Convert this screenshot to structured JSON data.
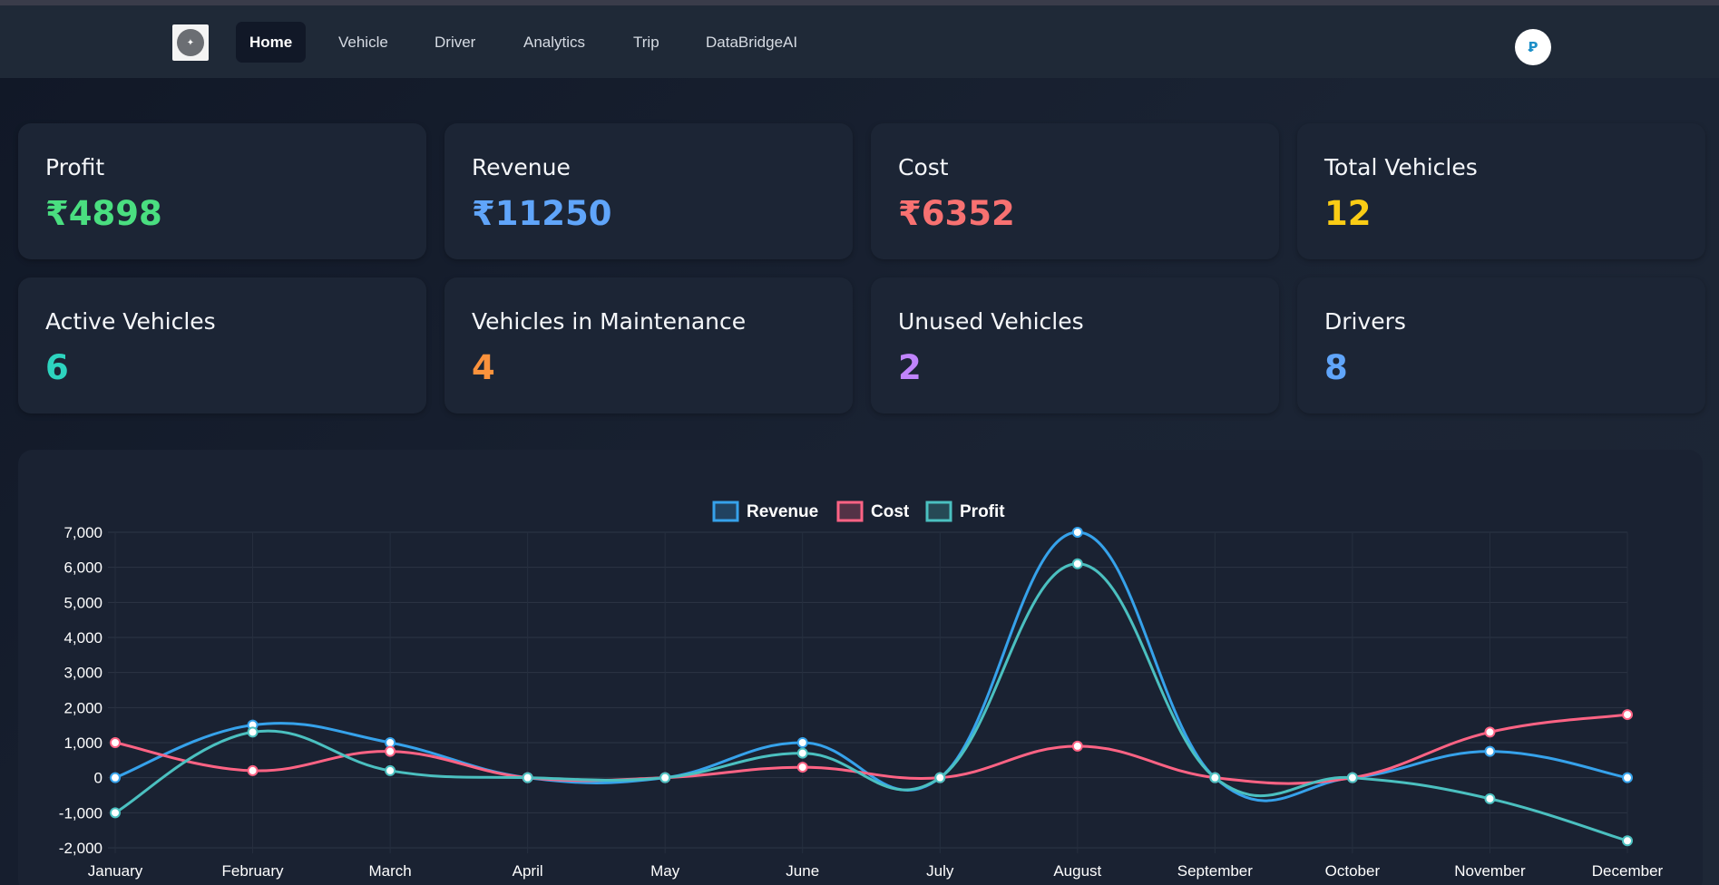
{
  "nav": {
    "logo_name": "company-logo",
    "items": [
      {
        "label": "Home",
        "active": true
      },
      {
        "label": "Vehicle",
        "active": false
      },
      {
        "label": "Driver",
        "active": false
      },
      {
        "label": "Analytics",
        "active": false
      },
      {
        "label": "Trip",
        "active": false
      },
      {
        "label": "DataBridgeAI",
        "active": false
      }
    ],
    "avatar_icon": "user-avatar-icon"
  },
  "cards": [
    {
      "label": "Profit",
      "value": "₹4898",
      "color": "#4ade80"
    },
    {
      "label": "Revenue",
      "value": "₹11250",
      "color": "#60a5fa"
    },
    {
      "label": "Cost",
      "value": "₹6352",
      "color": "#f87171"
    },
    {
      "label": "Total Vehicles",
      "value": "12",
      "color": "#facc15"
    },
    {
      "label": "Active Vehicles",
      "value": "6",
      "color": "#2dd4bf"
    },
    {
      "label": "Vehicles in Maintenance",
      "value": "4",
      "color": "#fb923c"
    },
    {
      "label": "Unused Vehicles",
      "value": "2",
      "color": "#c084fc"
    },
    {
      "label": "Drivers",
      "value": "8",
      "color": "#60a5fa"
    }
  ],
  "chart_data": {
    "type": "line",
    "categories": [
      "January",
      "February",
      "March",
      "April",
      "May",
      "June",
      "July",
      "August",
      "September",
      "October",
      "November",
      "December"
    ],
    "series": [
      {
        "name": "Revenue",
        "color": "#36a2eb",
        "values": [
          0,
          1500,
          1000,
          0,
          0,
          1000,
          0,
          7000,
          0,
          0,
          750,
          0
        ]
      },
      {
        "name": "Cost",
        "color": "#ff6384",
        "values": [
          1000,
          200,
          750,
          0,
          0,
          300,
          0,
          900,
          0,
          0,
          1300,
          1800
        ]
      },
      {
        "name": "Profit",
        "color": "#4bc0c0",
        "values": [
          -1000,
          1300,
          200,
          0,
          0,
          700,
          0,
          6100,
          0,
          0,
          -600,
          -1800
        ]
      }
    ],
    "yticks": [
      "7,000",
      "6,000",
      "5,000",
      "4,000",
      "3,000",
      "2,000",
      "1,000",
      "0",
      "-1,000",
      "-2,000"
    ],
    "ylim": [
      -2000,
      7000
    ],
    "grid": true,
    "legend": "top-center"
  }
}
